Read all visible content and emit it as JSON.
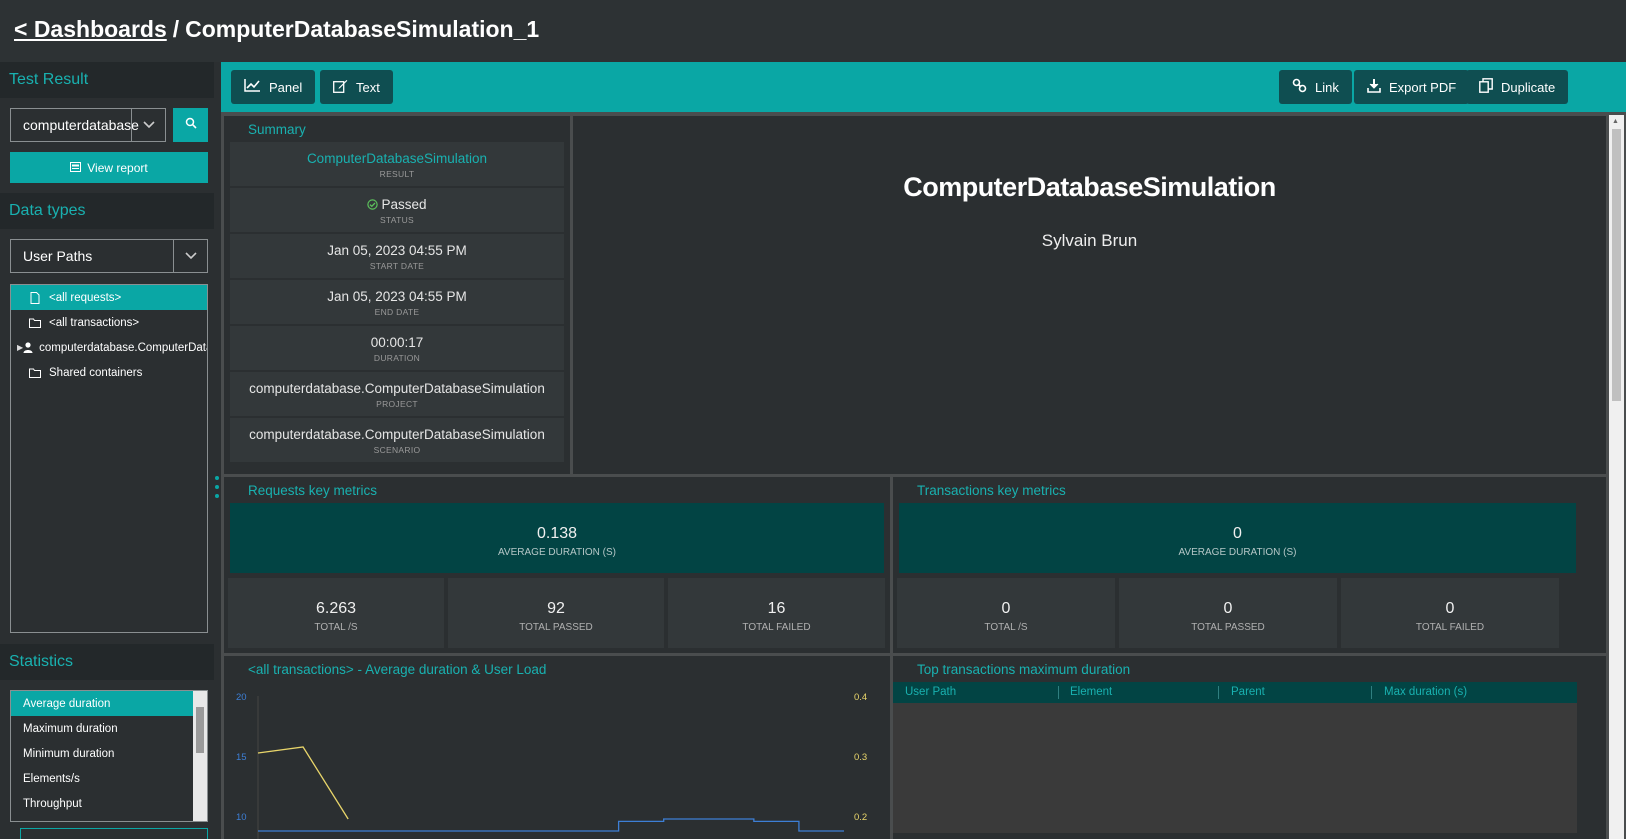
{
  "header": {
    "back_label": "< Dashboards",
    "separator": "/",
    "title": "ComputerDatabaseSimulation_1"
  },
  "sidebar": {
    "test_result_heading": "Test Result",
    "test_result_value": "computerdatabase",
    "view_report_label": "View report",
    "data_types_heading": "Data types",
    "data_type_value": "User Paths",
    "tree": [
      {
        "label": "<all requests>",
        "icon": "file-icon",
        "selected": true
      },
      {
        "label": "<all transactions>",
        "icon": "folder-icon",
        "selected": false
      },
      {
        "label": "computerdatabase.ComputerDatabaseSimulation",
        "icon": "user-icon",
        "selected": false,
        "expandable": true
      },
      {
        "label": "Shared containers",
        "icon": "folder-icon",
        "selected": false
      }
    ],
    "statistics_heading": "Statistics",
    "statistics": [
      "Average duration",
      "Maximum duration",
      "Minimum duration",
      "Elements/s",
      "Throughput"
    ]
  },
  "toolbar": {
    "panel_label": "Panel",
    "text_label": "Text",
    "link_label": "Link",
    "export_pdf_label": "Export PDF",
    "duplicate_label": "Duplicate"
  },
  "summary": {
    "title": "Summary",
    "rows": [
      {
        "value": "ComputerDatabaseSimulation",
        "label": "RESULT"
      },
      {
        "value": "Passed",
        "label": "STATUS"
      },
      {
        "value": "Jan 05, 2023 04:55 PM",
        "label": "START DATE"
      },
      {
        "value": "Jan 05, 2023 04:55 PM",
        "label": "END DATE"
      },
      {
        "value": "00:00:17",
        "label": "DURATION"
      },
      {
        "value": "computerdatabase.ComputerDatabaseSimulation",
        "label": "PROJECT"
      },
      {
        "value": "computerdatabase.ComputerDatabaseSimulation",
        "label": "SCENARIO"
      }
    ]
  },
  "text_panel": {
    "title": "ComputerDatabaseSimulation",
    "author": "Sylvain Brun"
  },
  "requests_metrics": {
    "title": "Requests key metrics",
    "avg_value": "0.138",
    "avg_label": "AVERAGE DURATION (S)",
    "items": [
      {
        "value": "6.263",
        "label": "TOTAL /S"
      },
      {
        "value": "92",
        "label": "TOTAL PASSED"
      },
      {
        "value": "16",
        "label": "TOTAL FAILED"
      }
    ]
  },
  "transactions_metrics": {
    "title": "Transactions key metrics",
    "avg_value": "0",
    "avg_label": "AVERAGE DURATION (S)",
    "items": [
      {
        "value": "0",
        "label": "TOTAL /S"
      },
      {
        "value": "0",
        "label": "TOTAL PASSED"
      },
      {
        "value": "0",
        "label": "TOTAL FAILED"
      }
    ]
  },
  "top_transactions": {
    "title": "Top transactions maximum duration",
    "columns": [
      "User Path",
      "Element",
      "Parent",
      "Max duration (s)"
    ]
  },
  "chart_title": "<all transactions> - Average duration & User Load",
  "chart_data": {
    "type": "line",
    "title": "<all transactions> - Average duration & User Load",
    "y_left_ticks": [
      "20",
      "15",
      "10"
    ],
    "y_right_ticks": [
      "0.4",
      "0.3",
      "0.2"
    ],
    "y_left_range": [
      10,
      20
    ],
    "y_right_range": [
      0.2,
      0.4
    ],
    "series": [
      {
        "axis": "left",
        "color": "#3d7fd6",
        "x": [
          0,
          1,
          2,
          3,
          4,
          5,
          6,
          7,
          8,
          9,
          10,
          11,
          12,
          13
        ],
        "values": [
          9,
          9,
          9,
          9,
          9,
          9,
          9,
          9,
          9.8,
          10,
          10,
          9.8,
          9,
          9
        ]
      },
      {
        "axis": "right",
        "color": "#e8d56a",
        "x": [
          0,
          1,
          2
        ],
        "values": [
          0.31,
          0.32,
          0.2
        ]
      }
    ]
  },
  "colors": {
    "accent": "#0aa7a5",
    "dark_teal": "#024444",
    "background": "#2b2f31"
  }
}
